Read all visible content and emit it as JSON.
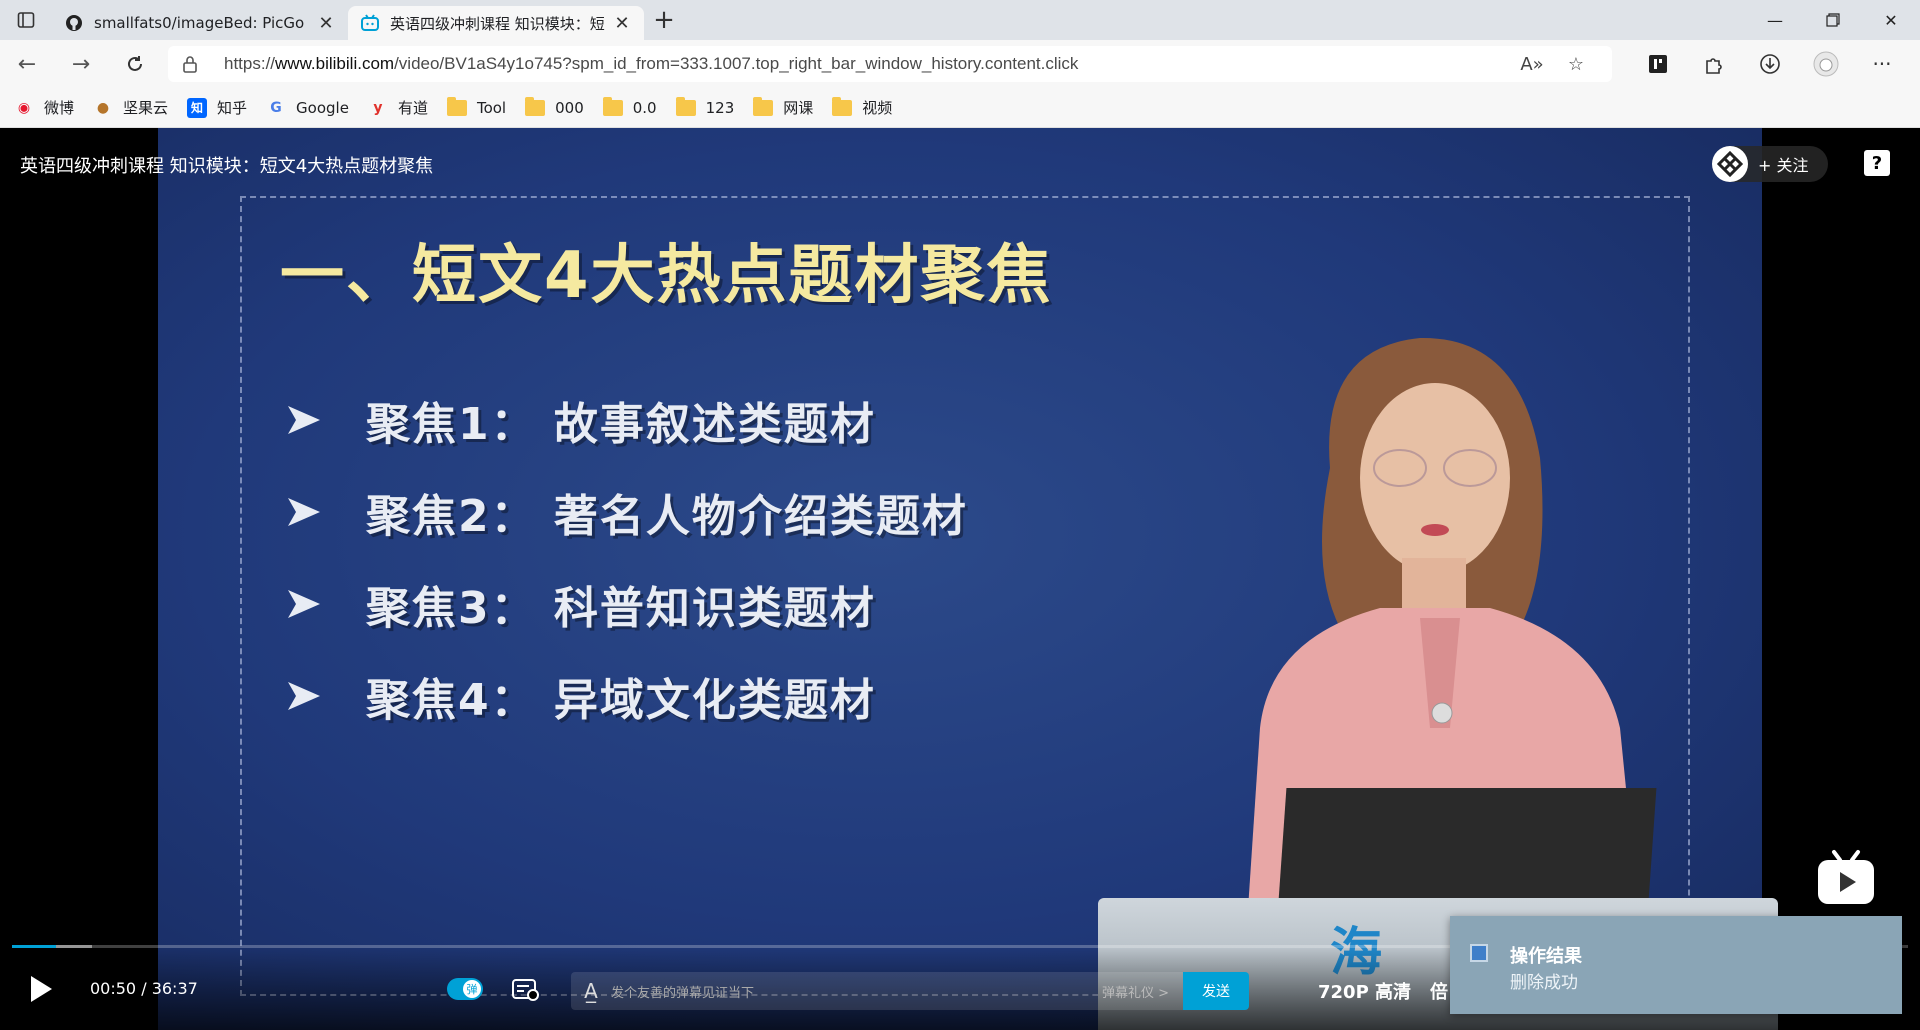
{
  "browser": {
    "tabs": [
      {
        "title": "smallfats0/imageBed: PicGo",
        "active": false,
        "favicon": "github-icon"
      },
      {
        "title": "英语四级冲刺课程 知识模块：短",
        "active": true,
        "favicon": "bilibili-icon"
      }
    ],
    "url_prefix": "https://",
    "url_domain": "www.bilibili.com",
    "url_path": "/video/BV1aS4y1o745?spm_id_from=333.1007.top_right_bar_window_history.content.click",
    "bookmarks": [
      {
        "label": "微博",
        "icon": "weibo-icon"
      },
      {
        "label": "坚果云",
        "icon": "nutstore-icon"
      },
      {
        "label": "知乎",
        "icon": "zhihu-icon"
      },
      {
        "label": "Google",
        "icon": "google-icon"
      },
      {
        "label": "有道",
        "icon": "youdao-icon"
      },
      {
        "label": "Tool",
        "icon": "folder-icon"
      },
      {
        "label": "000",
        "icon": "folder-icon"
      },
      {
        "label": "0.0",
        "icon": "folder-icon"
      },
      {
        "label": "123",
        "icon": "folder-icon"
      },
      {
        "label": "网课",
        "icon": "folder-icon"
      },
      {
        "label": "视频",
        "icon": "folder-icon"
      }
    ]
  },
  "video": {
    "title": "英语四级冲刺课程 知识模块：短文4大热点题材聚焦",
    "follow_label": "+ 关注",
    "help_label": "?",
    "slide": {
      "heading": "一、短文4大热点题材聚焦",
      "bullets": [
        "聚焦1：  故事叙述类题材",
        "聚焦2：  著名人物介绍类题材",
        "聚焦3：  科普知识类题材",
        "聚焦4：  异域文化类题材"
      ],
      "podium_text": "海"
    },
    "progress": 0.023,
    "buffered": 0.042,
    "current_time": "00:50",
    "separator": "/",
    "duration": "36:37",
    "danmaku_toggle_label": "弹",
    "danmaku_placeholder": "发个友善的弹幕见证当下",
    "danmaku_etiquette": "弹幕礼仪 >",
    "send_label": "发送",
    "quality": "720P 高清",
    "speed": "倍"
  },
  "toast": {
    "title": "操作结果",
    "message": "删除成功"
  },
  "colors": {
    "accent": "#00a1d6",
    "slide_bg": "#20397a",
    "heading": "#f5e9a0"
  }
}
